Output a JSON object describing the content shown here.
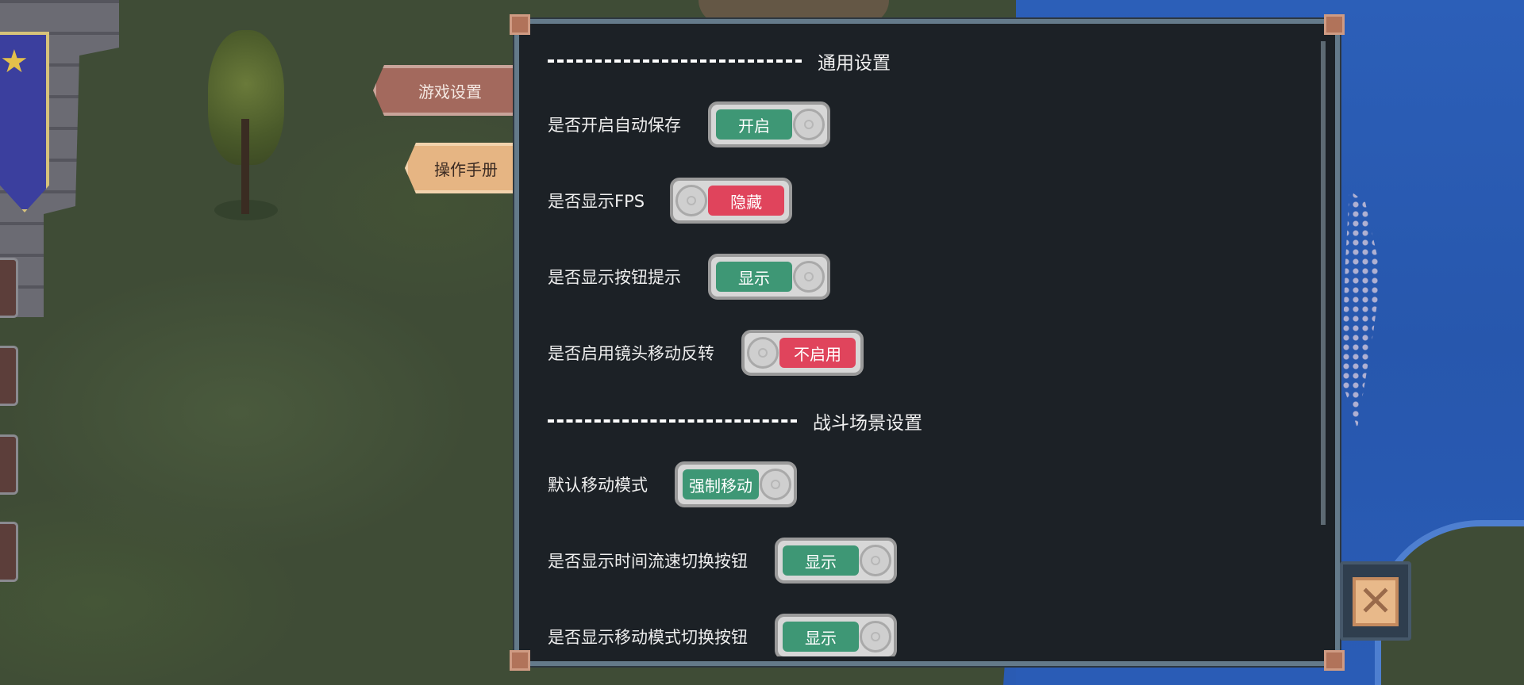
{
  "tabs": {
    "game_settings": "游戏设置",
    "manual": "操作手册"
  },
  "colors": {
    "toggle_on": "#3e9775",
    "toggle_off": "#e0445c"
  },
  "sections": [
    {
      "title": "通用设置",
      "settings": [
        {
          "label": "是否开启自动保存",
          "state_text": "开启",
          "on": true
        },
        {
          "label": "是否显示FPS",
          "state_text": "隐藏",
          "on": false
        },
        {
          "label": "是否显示按钮提示",
          "state_text": "显示",
          "on": true
        },
        {
          "label": "是否启用镜头移动反转",
          "state_text": "不启用",
          "on": false
        }
      ]
    },
    {
      "title": "战斗场景设置",
      "settings": [
        {
          "label": "默认移动模式",
          "state_text": "强制移动",
          "on": true
        },
        {
          "label": "是否显示时间流速切换按钮",
          "state_text": "显示",
          "on": true
        },
        {
          "label": "是否显示移动模式切换按钮",
          "state_text": "显示",
          "on": true
        }
      ]
    }
  ],
  "close_icon": "close-icon"
}
